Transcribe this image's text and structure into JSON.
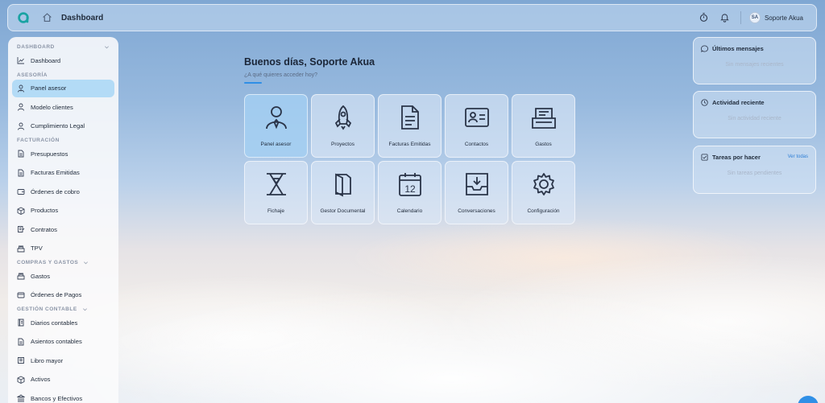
{
  "topbar": {
    "breadcrumb": "Dashboard",
    "user_initials": "SA",
    "user_name": "Soporte Akua",
    "icons": [
      "akua-logo-icon",
      "home-icon",
      "timer-icon",
      "bell-icon"
    ]
  },
  "sidebar": {
    "sections": [
      {
        "title": "DASHBOARD",
        "items": [
          {
            "label": "Dashboard",
            "icon": "chart-line-icon"
          }
        ]
      },
      {
        "title": "ASESORÍA",
        "items": [
          {
            "label": "Panel asesor",
            "icon": "advisor-icon",
            "active": true
          },
          {
            "label": "Modelo clientes",
            "icon": "user-icon"
          },
          {
            "label": "Cumplimiento Legal",
            "icon": "user-icon"
          }
        ]
      },
      {
        "title": "FACTURACIÓN",
        "items": [
          {
            "label": "Presupuestos",
            "icon": "document-icon"
          },
          {
            "label": "Facturas Emitidas",
            "icon": "document-icon"
          },
          {
            "label": "Órdenes de cobro",
            "icon": "wallet-icon"
          },
          {
            "label": "Productos",
            "icon": "box-icon"
          },
          {
            "label": "Contratos",
            "icon": "contract-icon"
          },
          {
            "label": "TPV",
            "icon": "register-icon"
          }
        ]
      },
      {
        "title": "COMPRAS Y GASTOS",
        "items": [
          {
            "label": "Gastos",
            "icon": "register-icon"
          },
          {
            "label": "Órdenes de Pagos",
            "icon": "card-icon"
          }
        ]
      },
      {
        "title": "GESTIÓN CONTABLE",
        "items": [
          {
            "label": "Diarios contables",
            "icon": "journal-icon"
          },
          {
            "label": "Asientos contables",
            "icon": "document-icon"
          },
          {
            "label": "Libro mayor",
            "icon": "book-icon"
          },
          {
            "label": "Activos",
            "icon": "box-icon"
          },
          {
            "label": "Bancos y Efectivos",
            "icon": "bank-icon"
          }
        ]
      }
    ]
  },
  "main": {
    "greeting": "Buenos días, Soporte Akua",
    "subtitle": "¿A qué quieres acceder hoy?",
    "tiles": [
      {
        "label": "Panel asesor",
        "icon": "advisor-icon",
        "active": true
      },
      {
        "label": "Proyectos",
        "icon": "rocket-icon"
      },
      {
        "label": "Facturas Emitidas",
        "icon": "document-icon"
      },
      {
        "label": "Contactos",
        "icon": "contact-card-icon"
      },
      {
        "label": "Gastos",
        "icon": "register-icon"
      },
      {
        "label": "Fichaje",
        "icon": "hourglass-icon"
      },
      {
        "label": "Gestor Documental",
        "icon": "folder-icon"
      },
      {
        "label": "Calendario",
        "icon": "calendar-icon",
        "day": "12"
      },
      {
        "label": "Conversaciones",
        "icon": "inbox-icon"
      },
      {
        "label": "Configuración",
        "icon": "gear-icon"
      }
    ]
  },
  "panels": {
    "messages": {
      "title": "Últimos mensajes",
      "empty": "Sin mensajes recientes"
    },
    "activity": {
      "title": "Actividad reciente",
      "empty": "Sin actividad reciente"
    },
    "tasks": {
      "title": "Tareas por hacer",
      "link": "Ver todas",
      "empty": "Sin tareas pendientes"
    }
  },
  "colors": {
    "accent": "#2f8fe6",
    "active_bg": "#b3dbf6",
    "logo": "#1aa3a3"
  }
}
